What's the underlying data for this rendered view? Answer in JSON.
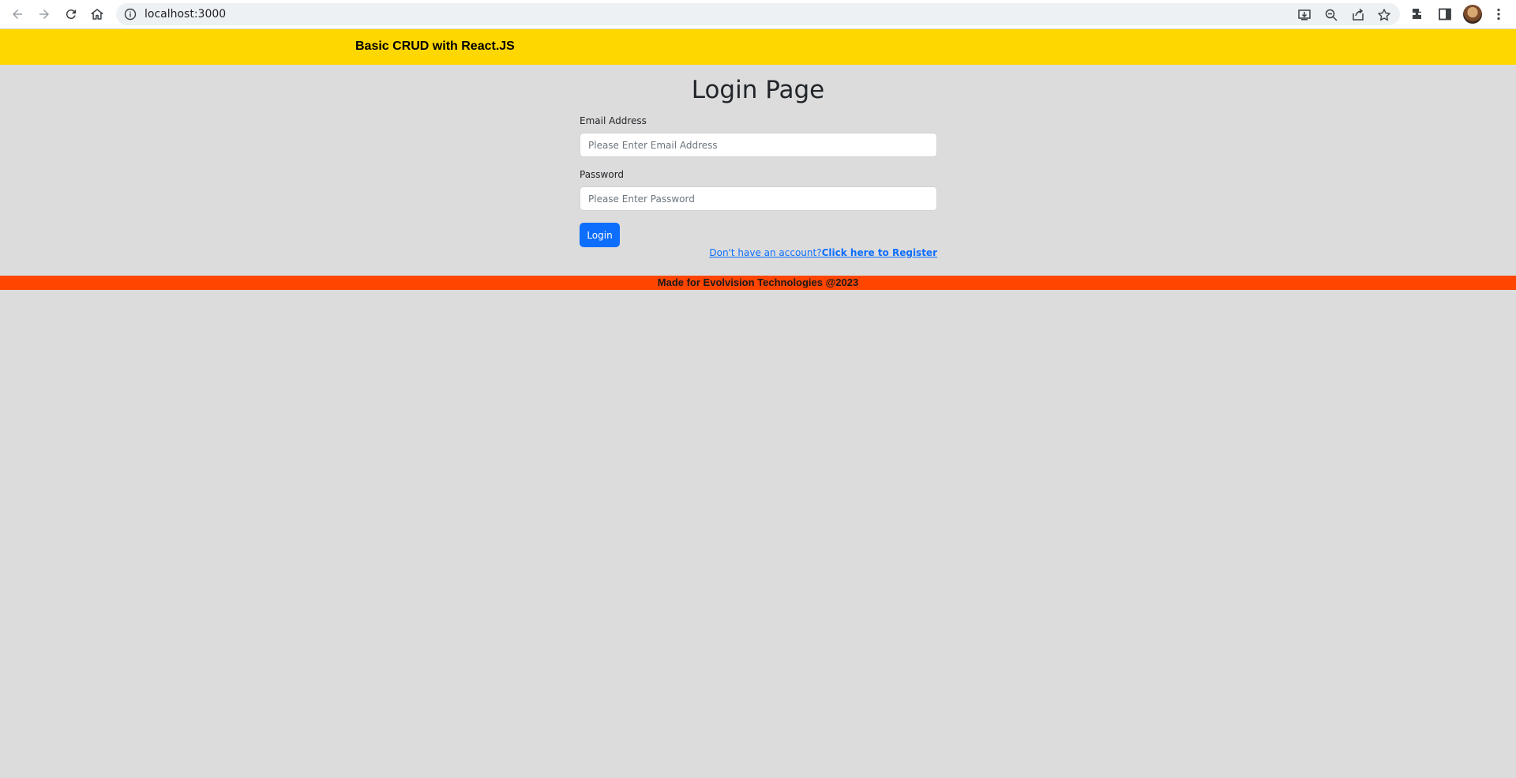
{
  "browser": {
    "url": "localhost:3000",
    "icons": [
      "back-icon",
      "forward-icon",
      "reload-icon",
      "home-icon",
      "info-icon",
      "install-icon",
      "zoom-icon",
      "share-icon",
      "bookmark-star-icon",
      "extensions-icon",
      "side-panel-icon",
      "profile-avatar",
      "menu-kebab-icon"
    ]
  },
  "navbar": {
    "brand": "Basic CRUD with React.JS",
    "color": "#ffd700"
  },
  "main": {
    "title": "Login Page",
    "email": {
      "label": "Email Address",
      "value": "",
      "placeholder": "Please Enter Email Address"
    },
    "password": {
      "label": "Password",
      "value": "",
      "placeholder": "Please Enter Password"
    },
    "login_button": "Login",
    "register_prompt": "Don't have an account?",
    "register_link": "Click here to Register",
    "accent_color": "#0d6efd"
  },
  "footer": {
    "text": "Made for Evolvision Technologies @2023",
    "color": "#ff4500"
  }
}
